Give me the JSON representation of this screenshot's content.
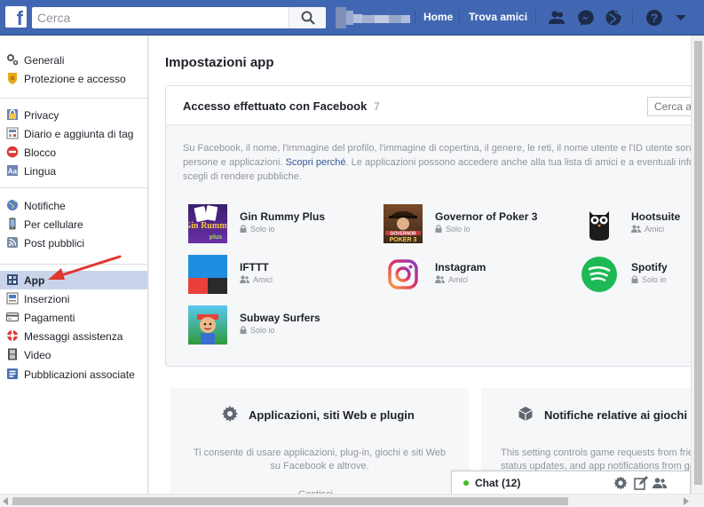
{
  "topbar": {
    "logo": "f",
    "search_placeholder": "Cerca",
    "nav_home": "Home",
    "nav_find_friends": "Trova amici",
    "icons": [
      "friend-requests-icon",
      "messenger-icon",
      "notifications-globe-icon",
      "help-icon",
      "caret-down-icon"
    ]
  },
  "leftnav": {
    "groups": [
      [
        {
          "label": "Generali",
          "icon": "gear-icon"
        },
        {
          "label": "Protezione e accesso",
          "icon": "shield-icon"
        }
      ],
      [
        {
          "label": "Privacy",
          "icon": "lock-icon"
        },
        {
          "label": "Diario e aggiunta di tag",
          "icon": "timeline-icon"
        },
        {
          "label": "Blocco",
          "icon": "block-icon"
        },
        {
          "label": "Lingua",
          "icon": "language-icon"
        }
      ],
      [
        {
          "label": "Notifiche",
          "icon": "globe-icon"
        },
        {
          "label": "Per cellulare",
          "icon": "mobile-icon"
        },
        {
          "label": "Post pubblici",
          "icon": "rss-icon"
        }
      ],
      [
        {
          "label": "App",
          "icon": "apps-icon",
          "active": true
        },
        {
          "label": "Inserzioni",
          "icon": "ads-icon"
        },
        {
          "label": "Pagamenti",
          "icon": "card-icon"
        },
        {
          "label": "Messaggi assistenza",
          "icon": "lifebuoy-icon"
        },
        {
          "label": "Video",
          "icon": "film-icon"
        },
        {
          "label": "Pubblicazioni associate",
          "icon": "linked-icon"
        }
      ]
    ]
  },
  "main": {
    "title": "Impostazioni app",
    "card": {
      "title": "Accesso effettuato con Facebook",
      "count": "7",
      "search_placeholder": "Cerca app",
      "desc_line1": "Su Facebook, il nome, l'immagine del profilo, l'immagine di copertina, il genere, le reti, il nome utente e l'ID utente sono sempre visibili a",
      "desc_line2a": "persone e applicazioni.",
      "desc_link": "Scopri perché",
      "desc_line2b": ". Le applicazioni possono accedere anche alla tua lista di amici e a eventuali informazioni che",
      "desc_line3": "scegli di rendere pubbliche."
    },
    "apps": [
      {
        "name": "Gin Rummy Plus",
        "privacy": "Solo io",
        "privacy_icon": "lock-icon"
      },
      {
        "name": "Governor of Poker 3",
        "privacy": "Solo io",
        "privacy_icon": "lock-icon"
      },
      {
        "name": "Hootsuite",
        "privacy": "Amici",
        "privacy_icon": "friends-icon"
      },
      {
        "name": "IFTTT",
        "privacy": "Amici",
        "privacy_icon": "friends-icon"
      },
      {
        "name": "Instagram",
        "privacy": "Amici",
        "privacy_icon": "friends-icon"
      },
      {
        "name": "Spotify",
        "privacy": "Solo io",
        "privacy_icon": "lock-icon"
      },
      {
        "name": "Subway Surfers",
        "privacy": "Solo io",
        "privacy_icon": "lock-icon"
      }
    ],
    "app_logo_text": {
      "gin_rummy": "Gin Rummy",
      "gin_rummy_plus": "plus",
      "governor": "GOVERNOR",
      "poker3": "POKER 3"
    },
    "panels": [
      {
        "title": "Applicazioni, siti Web e plugin",
        "icon": "gear-icon",
        "desc_line1": "Ti consente di usare applicazioni, plug-in, giochi e siti Web",
        "desc_line2": "su Facebook e altrove.",
        "action": "Gestisci..."
      },
      {
        "title": "Notifiche relative ai giochi",
        "icon": "cube-icon",
        "desc_line1": "This setting controls game requests from friends,",
        "desc_line2": "status updates, and app notifications from games"
      }
    ]
  },
  "chat": {
    "label": "Chat (12)",
    "icons": [
      "settings-icon",
      "compose-icon",
      "group-icon"
    ]
  },
  "colors": {
    "brand_blue": "#4267b2",
    "active_bg": "#c9d4ea",
    "link": "#365899",
    "annotation_arrow": "#e0372f"
  }
}
